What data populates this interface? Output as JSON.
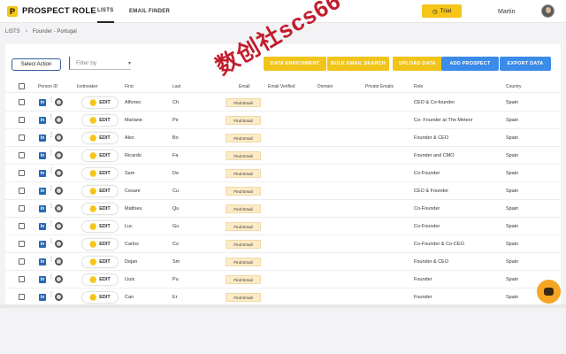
{
  "header": {
    "logo_letter": "P",
    "brand": "PROSPECT ROLE",
    "tabs": [
      {
        "label": "LISTS"
      },
      {
        "label": "EMAIL FINDER"
      }
    ],
    "trial_label": "Trial",
    "user_name": "Martin"
  },
  "breadcrumb": {
    "root": "LISTS",
    "separator": "›",
    "current": "Founder - Portugal"
  },
  "toolbar": {
    "select_action_label": "Select Action",
    "filter_placeholder": "Filter by",
    "buttons": [
      {
        "label": "DATA ENRICHMENT"
      },
      {
        "label": "BULK EMAIL SEARCH"
      },
      {
        "label": "UPLOAD DATA"
      },
      {
        "label": "ADD PROSPECT"
      },
      {
        "label": "EXPORT DATA"
      }
    ]
  },
  "table": {
    "columns": {
      "person_id": "Person ID",
      "icebreaker": "Icebreaker",
      "first": "First",
      "last": "Last",
      "email": "Email",
      "email_verified": "Email Verified",
      "domain": "Domain",
      "private_emails": "Private Emails",
      "role": "Role",
      "country": "Country"
    },
    "li_label": "in",
    "edit_label": "EDIT",
    "find_email_label": "Find Email",
    "rows": [
      {
        "first": "Alfonso",
        "last": "Ch",
        "role": "CEO & Co-founder",
        "country": "Spain"
      },
      {
        "first": "Mariane",
        "last": "Pe",
        "role": "Co- Founder at The Meteor",
        "country": "Spain"
      },
      {
        "first": "Alex",
        "last": "Bo",
        "role": "Founder & CEO",
        "country": "Spain"
      },
      {
        "first": "Ricardo",
        "last": "Fa",
        "role": "Founder and CMO",
        "country": "Spain"
      },
      {
        "first": "Sam",
        "last": "De",
        "role": "Co-Founder",
        "country": "Spain"
      },
      {
        "first": "Cesare",
        "last": "Cu",
        "role": "CEO & Founder",
        "country": "Spain"
      },
      {
        "first": "Mathieu",
        "last": "Qu",
        "role": "Co-Founder",
        "country": "Spain"
      },
      {
        "first": "Luc",
        "last": "Gu",
        "role": "Co-Founder",
        "country": "Spain"
      },
      {
        "first": "Carlos",
        "last": "Co",
        "role": "Co-Founder & Co-CEO",
        "country": "Spain"
      },
      {
        "first": "Dejan",
        "last": "Sm",
        "role": "Founder & CEO",
        "country": "Spain"
      },
      {
        "first": "Lluis",
        "last": "Pu",
        "role": "Founder",
        "country": "Spain"
      },
      {
        "first": "Can",
        "last": "Er",
        "role": "Founder",
        "country": "Spain"
      }
    ]
  },
  "watermark": "数创社scs66",
  "colors": {
    "brand_yellow": "#f5c518",
    "action_blue": "#3b8be8",
    "linkedin": "#2867b2",
    "chat_orange": "#f5a623",
    "watermark_red": "#c21e2e"
  }
}
